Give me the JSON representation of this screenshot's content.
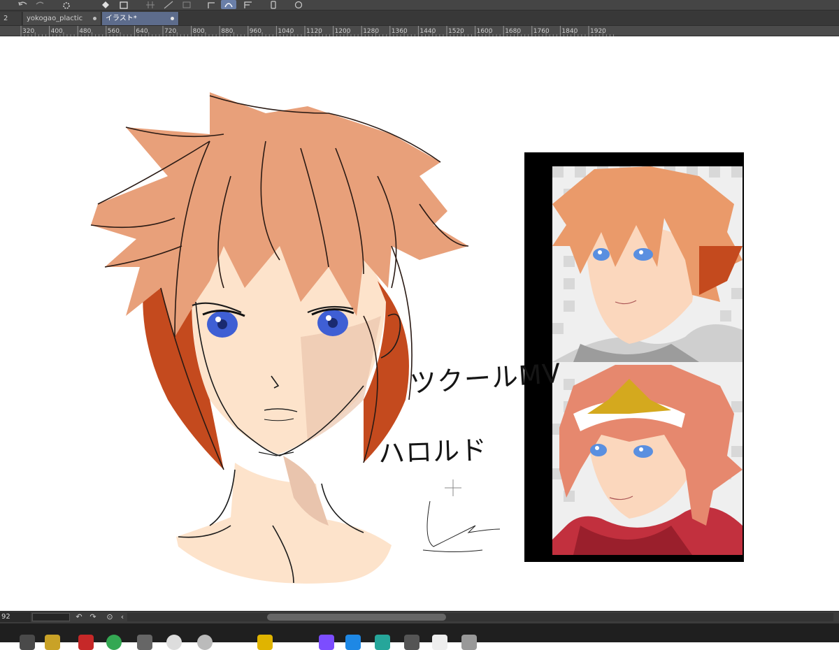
{
  "toolbar": {
    "icons": [
      "undo-icon",
      "redo-icon",
      "spinner-icon",
      "fill-icon",
      "select-icon",
      "grid-icon",
      "ruler-icon",
      "transform-icon",
      "curve-icon",
      "frame-icon",
      "device-icon",
      "chat-icon"
    ]
  },
  "tabs": [
    {
      "label": "2",
      "active": false
    },
    {
      "label": "yokogao_plactic",
      "active": false
    },
    {
      "label": "イラスト*",
      "active": true
    }
  ],
  "ruler": {
    "ticks": [
      "320",
      "400",
      "480",
      "560",
      "640",
      "720",
      "800",
      "880",
      "960",
      "1040",
      "1120",
      "1200",
      "1280",
      "1360",
      "1440",
      "1520",
      "1600",
      "1680",
      "1760",
      "1840",
      "1920"
    ]
  },
  "canvas": {
    "annotations": {
      "line1": "ツクールMV",
      "line2": "ハロルド"
    },
    "reference_panel": {
      "images": [
        "character-portrait-casual",
        "character-portrait-headband"
      ]
    },
    "colors": {
      "hair": "#e8a07a",
      "hair_shadow": "#c44a1e",
      "skin": "#fde3cb",
      "skin_shadow": "#e9c4ad",
      "eye": "#3f5fd4",
      "panel": "#000000"
    }
  },
  "status": {
    "zoom_value": "92"
  },
  "colors": {
    "toolbar": "#454545",
    "tab_active": "#5d6c8c",
    "ruler": "#4b4b4b",
    "taskbar": "#1f1f1f"
  }
}
